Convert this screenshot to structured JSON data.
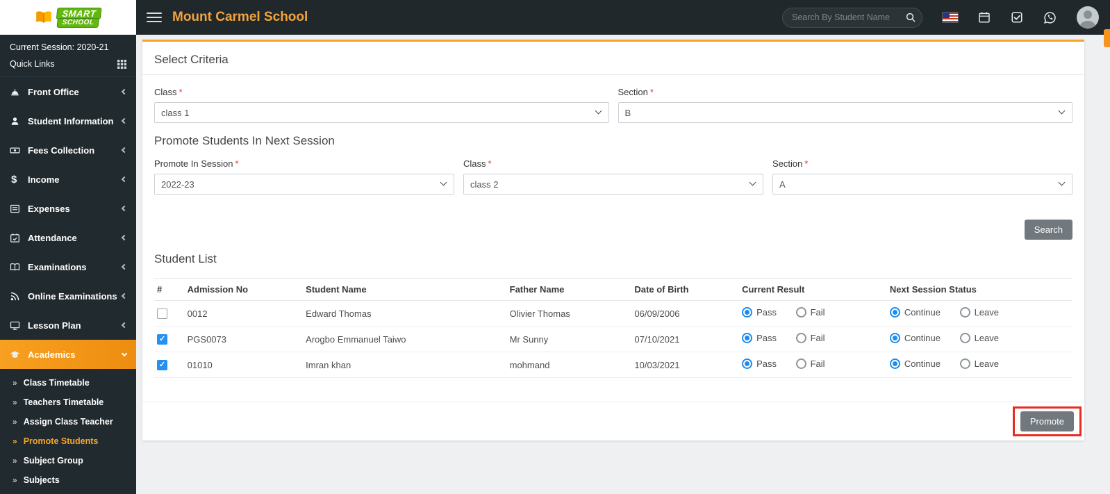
{
  "header": {
    "logo_line1": "SMART",
    "logo_line2": "SCHOOL",
    "school_name": "Mount Carmel School",
    "search_placeholder": "Search By Student Name",
    "icons": {
      "menu": "hamburger-icon",
      "search": "magnifier-icon",
      "language": "us-flag-icon",
      "calendar": "calendar-icon",
      "tasks": "task-check-icon",
      "chat": "chat-icon",
      "user": "avatar-icon",
      "theme": "theme-settings-tab"
    }
  },
  "sidebar": {
    "session_label": "Current Session: 2020-21",
    "quick_links_label": "Quick Links",
    "items": [
      {
        "label": "Front Office",
        "icon": "reception-bell-icon",
        "active": false
      },
      {
        "label": "Student Information",
        "icon": "student-icon",
        "active": false
      },
      {
        "label": "Fees Collection",
        "icon": "banknote-icon",
        "active": false
      },
      {
        "label": "Income",
        "icon": "dollar-icon",
        "active": false
      },
      {
        "label": "Expenses",
        "icon": "expense-list-icon",
        "active": false
      },
      {
        "label": "Attendance",
        "icon": "calendar-check-icon",
        "active": false
      },
      {
        "label": "Examinations",
        "icon": "open-book-icon",
        "active": false
      },
      {
        "label": "Online Examinations",
        "icon": "rss-icon",
        "active": false
      },
      {
        "label": "Lesson Plan",
        "icon": "board-icon",
        "active": false
      },
      {
        "label": "Academics",
        "icon": "graduation-cap-icon",
        "active": true
      }
    ],
    "submenu": [
      {
        "label": "Class Timetable",
        "active": false
      },
      {
        "label": "Teachers Timetable",
        "active": false
      },
      {
        "label": "Assign Class Teacher",
        "active": false
      },
      {
        "label": "Promote Students",
        "active": true
      },
      {
        "label": "Subject Group",
        "active": false
      },
      {
        "label": "Subjects",
        "active": false
      }
    ]
  },
  "main": {
    "select_criteria": {
      "title": "Select Criteria",
      "class_label": "Class",
      "class_value": "class 1",
      "section_label": "Section",
      "section_value": "B"
    },
    "promote_section": {
      "title": "Promote Students In Next Session",
      "session_label": "Promote In Session",
      "session_value": "2022-23",
      "class_label": "Class",
      "class_value": "class 2",
      "section_label": "Section",
      "section_value": "A"
    },
    "search_button_label": "Search",
    "student_list": {
      "title": "Student List",
      "columns": [
        "#",
        "Admission No",
        "Student Name",
        "Father Name",
        "Date of Birth",
        "Current Result",
        "Next Session Status"
      ],
      "result_options": [
        "Pass",
        "Fail"
      ],
      "status_options": [
        "Continue",
        "Leave"
      ],
      "rows": [
        {
          "selected": false,
          "admission_no": "0012",
          "student_name": "Edward Thomas",
          "father_name": "Olivier Thomas",
          "date_of_birth": "06/09/2006",
          "current_result": "Pass",
          "next_session_status": "Continue"
        },
        {
          "selected": true,
          "admission_no": "PGS0073",
          "student_name": "Arogbo Emmanuel Taiwo",
          "father_name": "Mr Sunny",
          "date_of_birth": "07/10/2021",
          "current_result": "Pass",
          "next_session_status": "Continue"
        },
        {
          "selected": true,
          "admission_no": "01010",
          "student_name": "Imran khan",
          "father_name": "mohmand",
          "date_of_birth": "10/03/2021",
          "current_result": "Pass",
          "next_session_status": "Continue"
        }
      ]
    },
    "promote_button_label": "Promote"
  },
  "colors": {
    "accent_orange": "#f7a22a",
    "active_blue": "#1d8cf0",
    "required_red": "#e53935",
    "annotation_red": "#ea2a1f",
    "header_bg": "#20282c",
    "sidebar_bg": "#212a2e",
    "logo_green": "#63b80f"
  }
}
